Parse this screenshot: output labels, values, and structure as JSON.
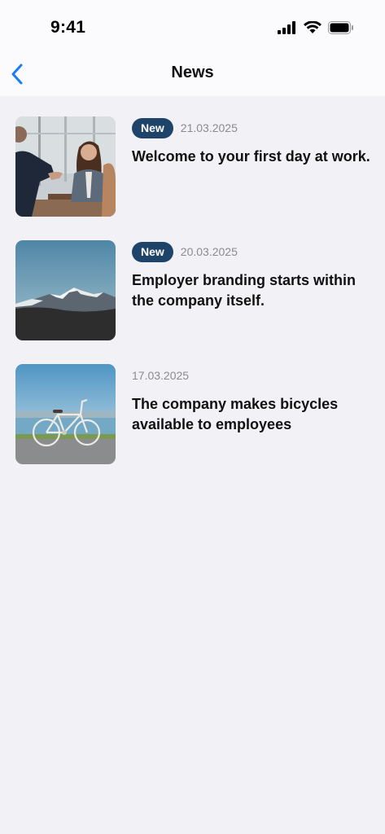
{
  "status_bar": {
    "time": "9:41"
  },
  "nav": {
    "title": "News"
  },
  "news": [
    {
      "badge": "New",
      "date": "21.03.2025",
      "title": "Welcome to your first day at work.",
      "image": "office-meeting-photo"
    },
    {
      "badge": "New",
      "date": "20.03.2025",
      "title": "Employer branding starts within the company itself.",
      "image": "mountain-photo"
    },
    {
      "badge": "",
      "date": "17.03.2025",
      "title": "The company makes bicycles available to employees",
      "image": "bicycle-photo"
    }
  ],
  "colors": {
    "badge": "#1e4469",
    "accent": "#1a7cf5",
    "background": "#f2f1f6",
    "date": "#8a8a8f"
  }
}
